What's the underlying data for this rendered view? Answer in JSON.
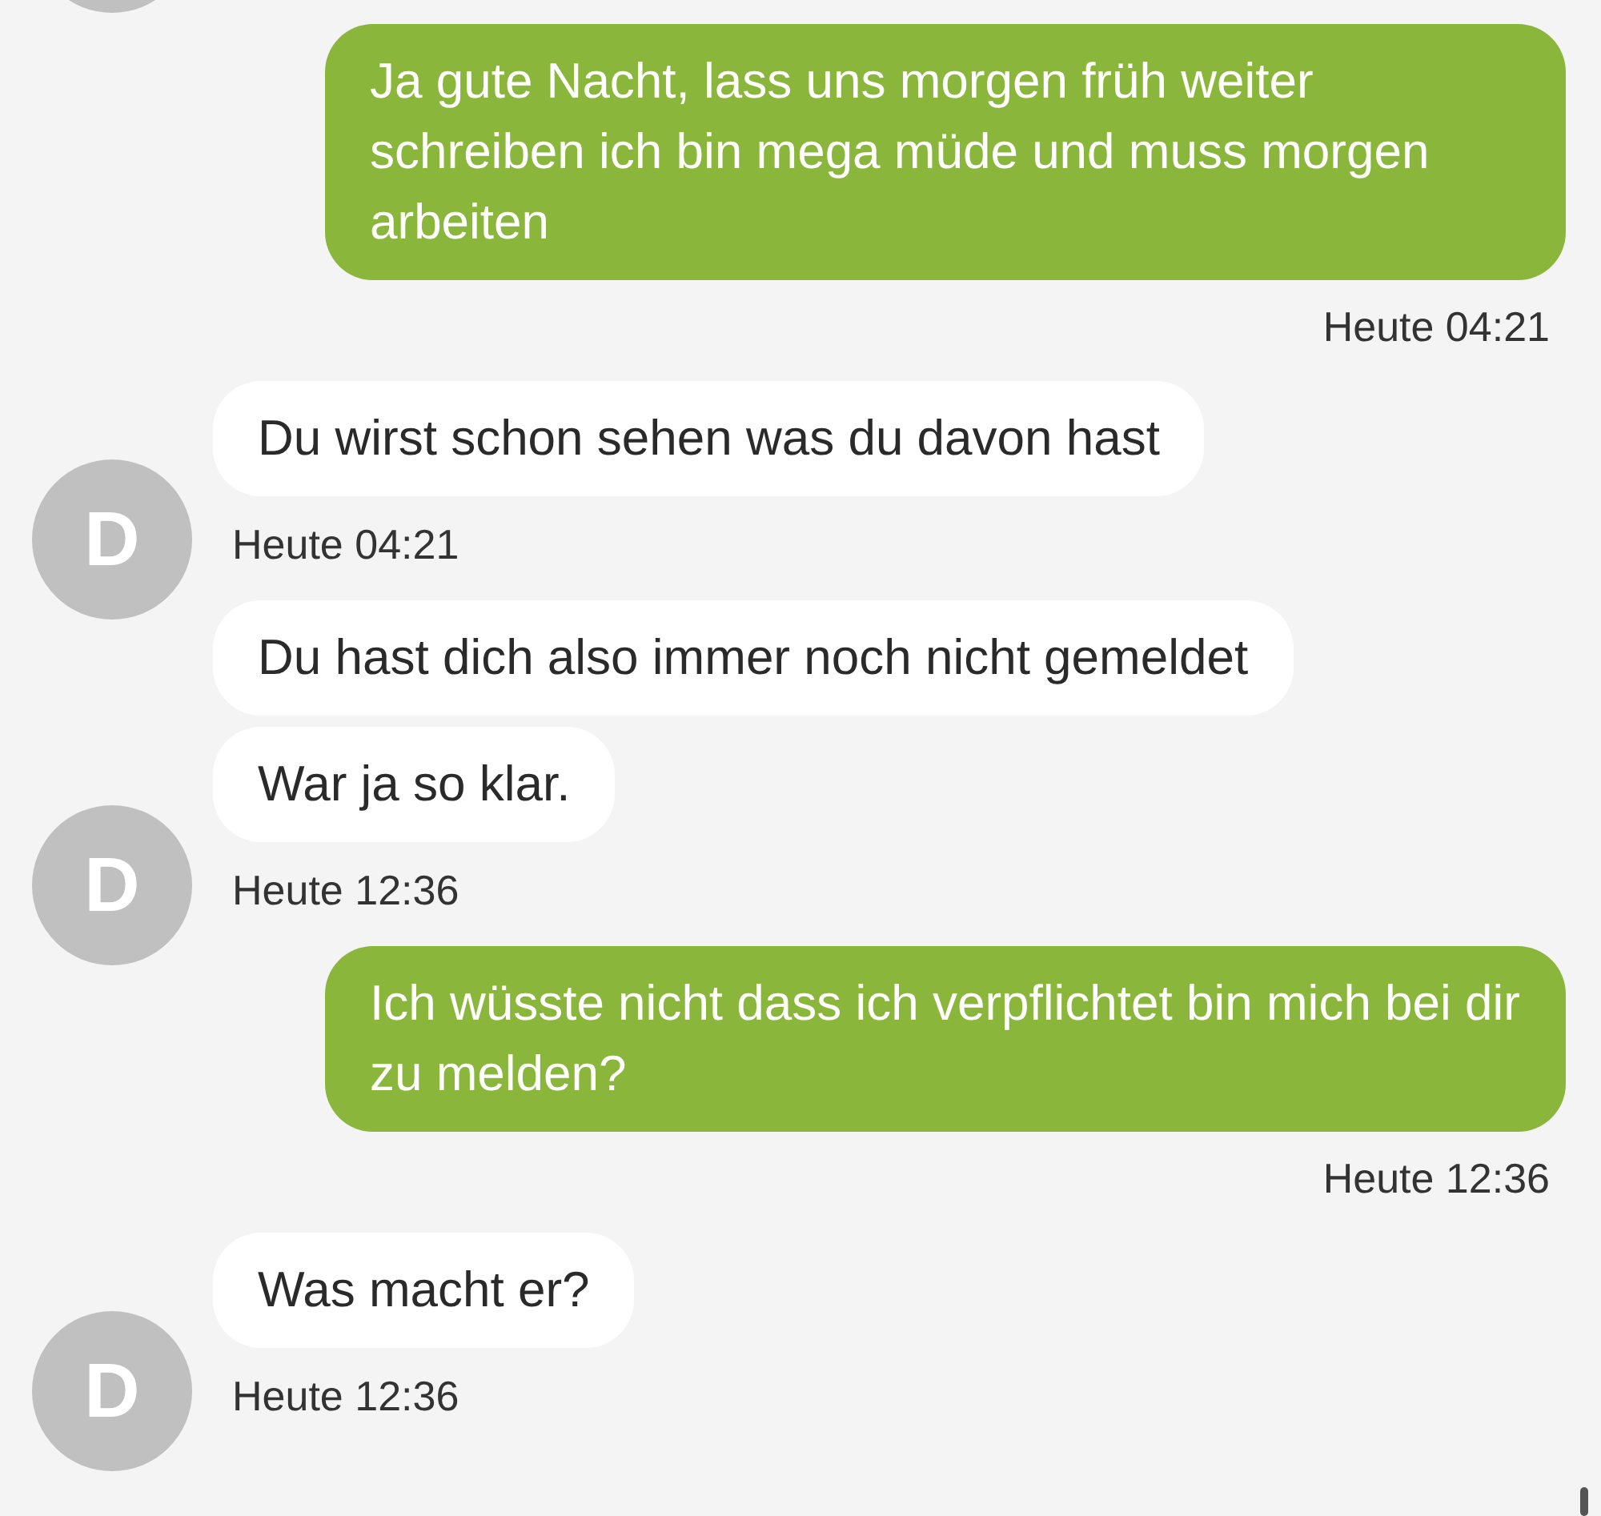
{
  "messages": [
    {
      "kind": "outgoing",
      "texts": [
        "Ja gute Nacht, lass uns morgen früh weiter schreiben ich bin mega müde und muss morgen arbeiten"
      ],
      "time": "Heute 04:21"
    },
    {
      "kind": "incoming",
      "avatar": "D",
      "texts": [
        "Du wirst schon sehen was du davon hast"
      ],
      "time": "Heute 04:21"
    },
    {
      "kind": "incoming",
      "avatar": "D",
      "texts": [
        "Du hast dich also immer noch nicht gemeldet",
        "War ja so klar."
      ],
      "time": "Heute 12:36"
    },
    {
      "kind": "outgoing",
      "texts": [
        "Ich wüsste nicht dass ich verpflichtet bin mich bei dir zu melden?"
      ],
      "time": "Heute 12:36"
    },
    {
      "kind": "incoming",
      "avatar": "D",
      "texts": [
        "Was macht er?"
      ],
      "time": "Heute 12:36"
    }
  ]
}
